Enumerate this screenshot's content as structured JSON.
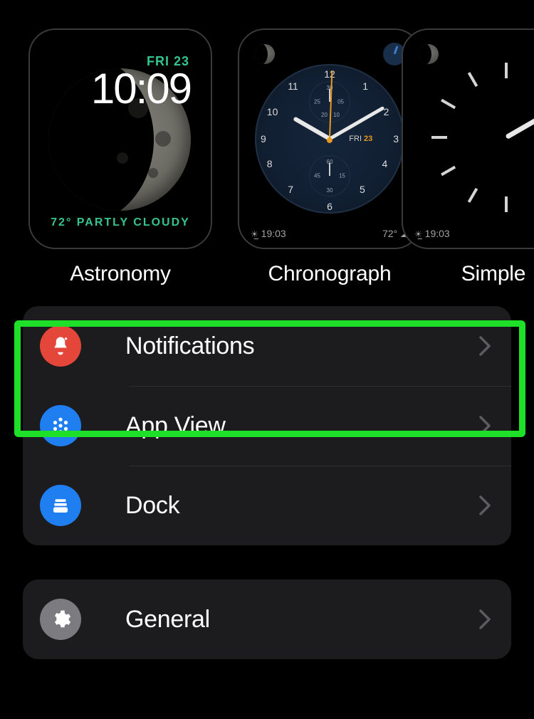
{
  "faces": [
    {
      "name": "Astronomy",
      "date_label": "FRI 23",
      "time": "10:09",
      "weather": "72° PARTLY CLOUDY"
    },
    {
      "name": "Chronograph",
      "day_label": "FRI",
      "day_num": "23",
      "sunset_time": "19:03",
      "temp": "72°",
      "top_subdial_values": {
        "top": "30",
        "r": "05",
        "l": "25",
        "bl": "20",
        "br": "10"
      },
      "bot_subdial_values": {
        "top": "60",
        "r": "15",
        "l": "45",
        "b": "30"
      }
    },
    {
      "name": "Simple",
      "sunset_time": "19:03"
    }
  ],
  "groups": [
    {
      "rows": [
        {
          "key": "notifications",
          "label": "Notifications",
          "icon": "bell",
          "color": "red"
        },
        {
          "key": "appview",
          "label": "App View",
          "icon": "apps",
          "color": "blue"
        },
        {
          "key": "dock",
          "label": "Dock",
          "icon": "dock",
          "color": "blue"
        }
      ]
    },
    {
      "rows": [
        {
          "key": "general",
          "label": "General",
          "icon": "gear",
          "color": "gray"
        }
      ]
    }
  ],
  "highlight_row_key": "notifications"
}
